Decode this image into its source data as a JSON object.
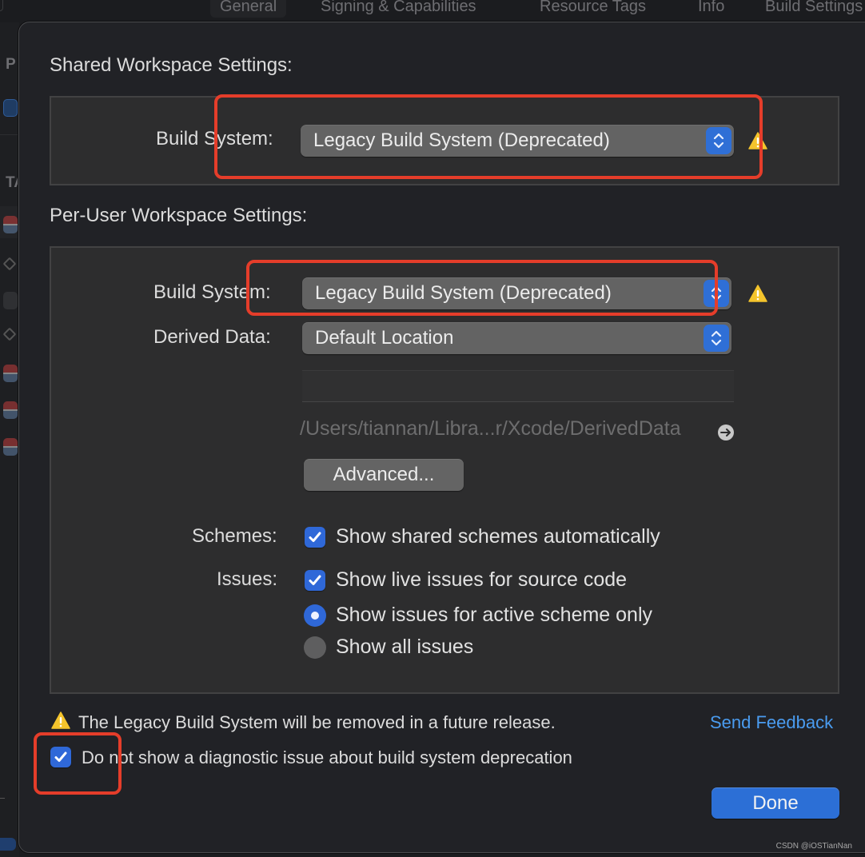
{
  "background": {
    "tabs": [
      {
        "label": "General",
        "active": true
      },
      {
        "label": "Signing & Capabilities",
        "active": false
      },
      {
        "label": "Resource Tags",
        "active": false
      },
      {
        "label": "Info",
        "active": false
      },
      {
        "label": "Build Settings",
        "active": false
      }
    ],
    "sidebar": {
      "project_header": "P",
      "targets_header": "TA"
    }
  },
  "sheet": {
    "shared": {
      "title": "Shared Workspace Settings:",
      "build_system_label": "Build System:",
      "build_system_value": "Legacy Build System (Deprecated)",
      "warning_icon": "warning-triangle-icon"
    },
    "per_user": {
      "title": "Per-User Workspace Settings:",
      "build_system_label": "Build System:",
      "build_system_value": "Legacy Build System (Deprecated)",
      "derived_data_label": "Derived Data:",
      "derived_data_value": "Default Location",
      "derived_data_path_field": "",
      "derived_data_path": "/Users/tiannan/Libra...r/Xcode/DerivedData",
      "advanced_button": "Advanced...",
      "schemes_label": "Schemes:",
      "schemes_option": {
        "label": "Show shared schemes automatically",
        "checked": true
      },
      "issues_label": "Issues:",
      "issues_live": {
        "label": "Show live issues for source code",
        "checked": true
      },
      "issues_scope_options": [
        {
          "label": "Show issues for active scheme only",
          "selected": true
        },
        {
          "label": "Show all issues",
          "selected": false
        }
      ]
    },
    "footer": {
      "deprecation_notice": "The Legacy Build System will be removed in a future release.",
      "send_feedback_link": "Send Feedback",
      "suppress_checkbox": {
        "label": "Do not show a diagnostic issue about build system deprecation",
        "checked": true
      },
      "done_button": "Done"
    }
  },
  "colors": {
    "accent": "#2f68d8",
    "link": "#4a9cf0",
    "annotation": "#e53d2a",
    "warning": "#f4c42c"
  },
  "watermark": "CSDN @iOSTianNan"
}
